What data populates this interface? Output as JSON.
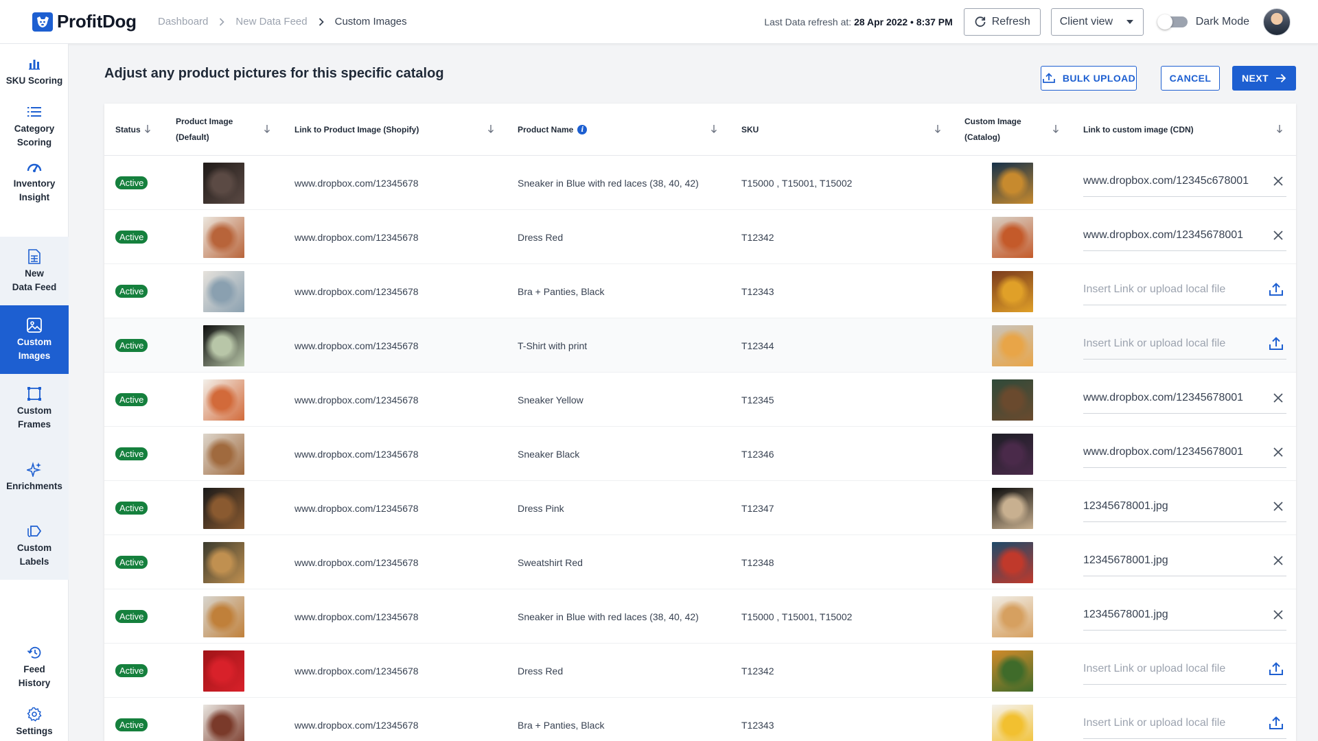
{
  "app": {
    "name": "ProfitDog"
  },
  "breadcrumb": [
    "Dashboard",
    "New Data Feed",
    "Custom Images"
  ],
  "header": {
    "refresh_prefix": "Last Data refresh at:",
    "refresh_date": "28 Apr 2022 • 8:37 PM",
    "refresh_button": "Refresh",
    "view_select": "Client view",
    "dark_mode_label": "Dark Mode"
  },
  "sidebar": [
    {
      "line1": "SKU Scoring",
      "line2": "",
      "icon": "bar-chart-icon"
    },
    {
      "line1": "Category",
      "line2": "Scoring",
      "icon": "list-icon"
    },
    {
      "line1": "Inventory",
      "line2": "Insight",
      "icon": "gauge-icon"
    },
    {
      "line1": "New",
      "line2": "Data Feed",
      "icon": "spreadsheet-icon"
    },
    {
      "line1": "Custom",
      "line2": "Images",
      "icon": "image-icon"
    },
    {
      "line1": "Custom",
      "line2": "Frames",
      "icon": "frame-icon"
    },
    {
      "line1": "Enrichments",
      "line2": "",
      "icon": "sparkle-icon"
    },
    {
      "line1": "Custom",
      "line2": "Labels",
      "icon": "label-icon"
    },
    {
      "line1": "Feed",
      "line2": "History",
      "icon": "history-icon"
    },
    {
      "line1": "Settings",
      "line2": "",
      "icon": "gear-icon"
    }
  ],
  "page": {
    "title": "Adjust any product pictures for this specific catalog",
    "bulk_upload": "BULK UPLOAD",
    "cancel": "CANCEL",
    "next": "NEXT"
  },
  "table": {
    "columns": {
      "status": "Status",
      "product_image_1": "Product Image",
      "product_image_2": "(Default)",
      "link_shopify": "Link to Product Image (Shopify)",
      "product_name": "Product Name",
      "sku": "SKU",
      "custom_image_1": "Custom Image",
      "custom_image_2": "(Catalog)",
      "link_cdn": "Link to custom image (CDN)"
    },
    "placeholder": "Insert Link or upload local file",
    "rows": [
      {
        "status": "Active",
        "link": "www.dropbox.com/12345678",
        "name": "Sneaker in Blue with red laces (38, 40, 42)",
        "sku": "T15000 , T15001, T15002",
        "cdn": "www.dropbox.com/12345c678001",
        "product_colors": [
          "#5b4a44",
          "#1f1a18"
        ],
        "custom_colors": [
          "#c78a2e",
          "#15304a"
        ]
      },
      {
        "status": "Active",
        "link": "www.dropbox.com/12345678",
        "name": "Dress Red",
        "sku": "T12342",
        "cdn": "www.dropbox.com/12345678001",
        "product_colors": [
          "#b8643a",
          "#ece7df"
        ],
        "custom_colors": [
          "#c45a2a",
          "#d8cfc4"
        ]
      },
      {
        "status": "Active",
        "link": "www.dropbox.com/12345678",
        "name": "Bra + Panties, Black",
        "sku": "T12343",
        "cdn": "",
        "product_colors": [
          "#8aa0b0",
          "#e6e2dc"
        ],
        "custom_colors": [
          "#e0a028",
          "#7a3a1c"
        ]
      },
      {
        "status": "Active",
        "link": "www.dropbox.com/12345678",
        "name": "T-Shirt with print",
        "sku": "T12344",
        "cdn": "",
        "product_colors": [
          "#b8c6a8",
          "#0e0e0e"
        ],
        "custom_colors": [
          "#e8a548",
          "#c9c4bc"
        ]
      },
      {
        "status": "Active",
        "link": "www.dropbox.com/12345678",
        "name": "Sneaker Yellow",
        "sku": "T12345",
        "cdn": "www.dropbox.com/12345678001",
        "product_colors": [
          "#d26a3a",
          "#f3f0ea"
        ],
        "custom_colors": [
          "#6a4a2e",
          "#2f4a3a"
        ]
      },
      {
        "status": "Active",
        "link": "www.dropbox.com/12345678",
        "name": "Sneaker Black",
        "sku": "T12346",
        "cdn": "www.dropbox.com/12345678001",
        "product_colors": [
          "#a06a3e",
          "#ddd6cc"
        ],
        "custom_colors": [
          "#4a2a4a",
          "#1e1e26"
        ]
      },
      {
        "status": "Active",
        "link": "www.dropbox.com/12345678",
        "name": "Dress Pink",
        "sku": "T12347",
        "cdn": "12345678001.jpg",
        "product_colors": [
          "#8a5a30",
          "#1a1a1a"
        ],
        "custom_colors": [
          "#c8b090",
          "#0d0d0d"
        ]
      },
      {
        "status": "Active",
        "link": "www.dropbox.com/12345678",
        "name": "Sweatshirt Red",
        "sku": "T12348",
        "cdn": "12345678001.jpg",
        "product_colors": [
          "#c09050",
          "#3a3a2e"
        ],
        "custom_colors": [
          "#c0392b",
          "#1e4a6a"
        ]
      },
      {
        "status": "Active",
        "link": "www.dropbox.com/12345678",
        "name": "Sneaker in Blue with red laces (38, 40, 42)",
        "sku": "T15000 , T15001, T15002",
        "cdn": "12345678001.jpg",
        "product_colors": [
          "#c0803a",
          "#d8d6d0"
        ],
        "custom_colors": [
          "#d6a060",
          "#f0ece4"
        ]
      },
      {
        "status": "Active",
        "link": "www.dropbox.com/12345678",
        "name": "Dress Red",
        "sku": "T12342",
        "cdn": "",
        "product_colors": [
          "#d8212a",
          "#a01418"
        ],
        "custom_colors": [
          "#3f6b2a",
          "#d08a2a"
        ]
      },
      {
        "status": "Active",
        "link": "www.dropbox.com/12345678",
        "name": "Bra + Panties, Black",
        "sku": "T12343",
        "cdn": "",
        "product_colors": [
          "#7a3a2a",
          "#e9e6e1"
        ],
        "custom_colors": [
          "#f2c030",
          "#f4f2ee"
        ]
      }
    ]
  }
}
